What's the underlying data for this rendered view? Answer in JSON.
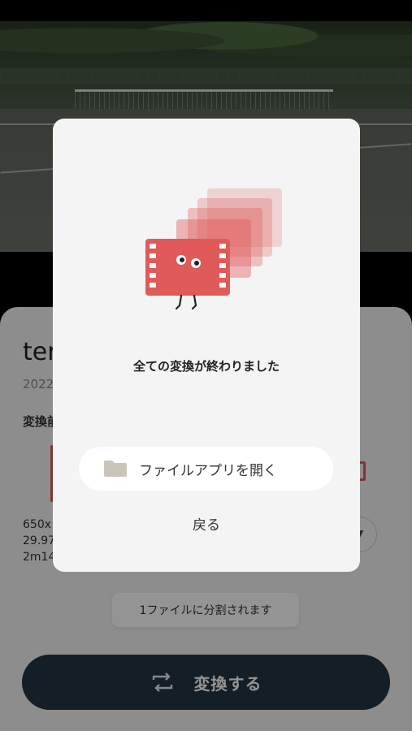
{
  "sheet": {
    "title": "ter",
    "date": "2022",
    "section_label": "変換前",
    "info_lines": [
      "650x",
      "29.97",
      "2m14"
    ],
    "split_note": "1ファイルに分割されます",
    "convert_label": "変換する"
  },
  "modal": {
    "message": "全ての変換が終わりました",
    "open_files_label": "ファイルアプリを開く",
    "back_label": "戻る"
  },
  "icons": {
    "folder": "folder-icon",
    "convert": "convert-arrows-icon",
    "dropdown": "chevron-down-icon",
    "mascot": "film-mascot-illustration"
  },
  "colors": {
    "accent_red": "#e05a5a",
    "button_dark": "#233444",
    "modal_bg": "#f4f4f4",
    "folder_gray": "#c9c6b8"
  }
}
